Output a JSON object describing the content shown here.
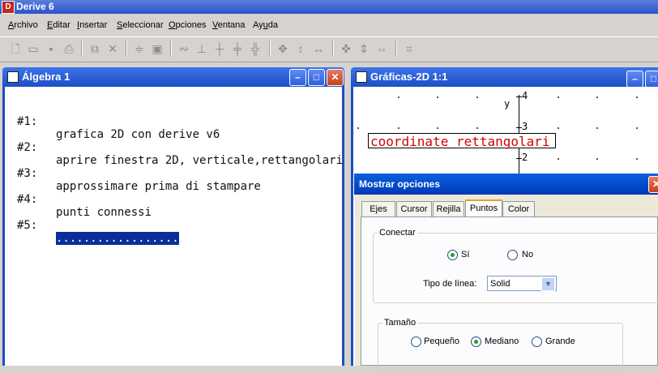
{
  "app": {
    "title": "Derive 6",
    "logo_letter": "D"
  },
  "menu": [
    {
      "label": "Archivo",
      "mnemonic": "A",
      "rest": "rchivo"
    },
    {
      "label": "Editar",
      "mnemonic": "E",
      "rest": "ditar"
    },
    {
      "label": "Insertar",
      "mnemonic": "I",
      "rest": "nsertar"
    },
    {
      "label": "Seleccionar",
      "mnemonic": "S",
      "rest": "eleccionar"
    },
    {
      "label": "Opciones",
      "mnemonic": "O",
      "rest": "pciones"
    },
    {
      "label": "Ventana",
      "mnemonic": "V",
      "rest": "entana"
    },
    {
      "label": "Ayuda",
      "pre": "Ay",
      "mnemonic": "u",
      "rest": "da"
    }
  ],
  "toolbar": {
    "icons": [
      "new-file-icon",
      "open-folder-icon",
      "save-icon",
      "print-icon",
      "copy-icon",
      "delete-icon",
      "simplify-icon",
      "approximate-icon",
      "expand-icon",
      "factor-icon",
      "integrate-icon",
      "differentiate-icon",
      "limit-icon",
      "move-icon",
      "vertical-icon",
      "horizontal-icon",
      "center-icon",
      "zoom-in-icon",
      "zoom-out-icon",
      "zoom-icon"
    ]
  },
  "algebra_window": {
    "title": "Álgebra 1",
    "expressions": [
      {
        "label": "#1:",
        "text": "grafica 2D con derive v6"
      },
      {
        "label": "#2:",
        "text": "aprire finestra 2D, verticale,rettangolari"
      },
      {
        "label": "#3:",
        "text": "approssimare prima di stampare"
      },
      {
        "label": "#4:",
        "text": "punti connessi"
      },
      {
        "label": "#5:",
        "text": "..................",
        "selected": true
      }
    ]
  },
  "graphics_window": {
    "title": "Gráficas-2D 1:1",
    "axis_label_y": "y",
    "ticks": [
      "4",
      "3",
      "2"
    ],
    "annotation": "coordinate rettangolari"
  },
  "dialog": {
    "title": "Mostrar opciones",
    "tabs": [
      "Ejes",
      "Cursor",
      "Rejilla",
      "Puntos",
      "Color"
    ],
    "active_tab": "Puntos",
    "conectar": {
      "legend": "Conectar",
      "yes_label": "Sí",
      "no_label": "No",
      "selected": "Sí"
    },
    "line_type": {
      "label": "Tipo de línea:",
      "value": "Solid"
    },
    "size": {
      "legend": "Tamaño",
      "options": [
        "Pequeño",
        "Mediano",
        "Grande"
      ],
      "selected": "Mediano"
    }
  },
  "colors": {
    "title_blue": "#1d4ec4",
    "annotation_red": "#d40000",
    "selection": "#0a2f9c"
  }
}
